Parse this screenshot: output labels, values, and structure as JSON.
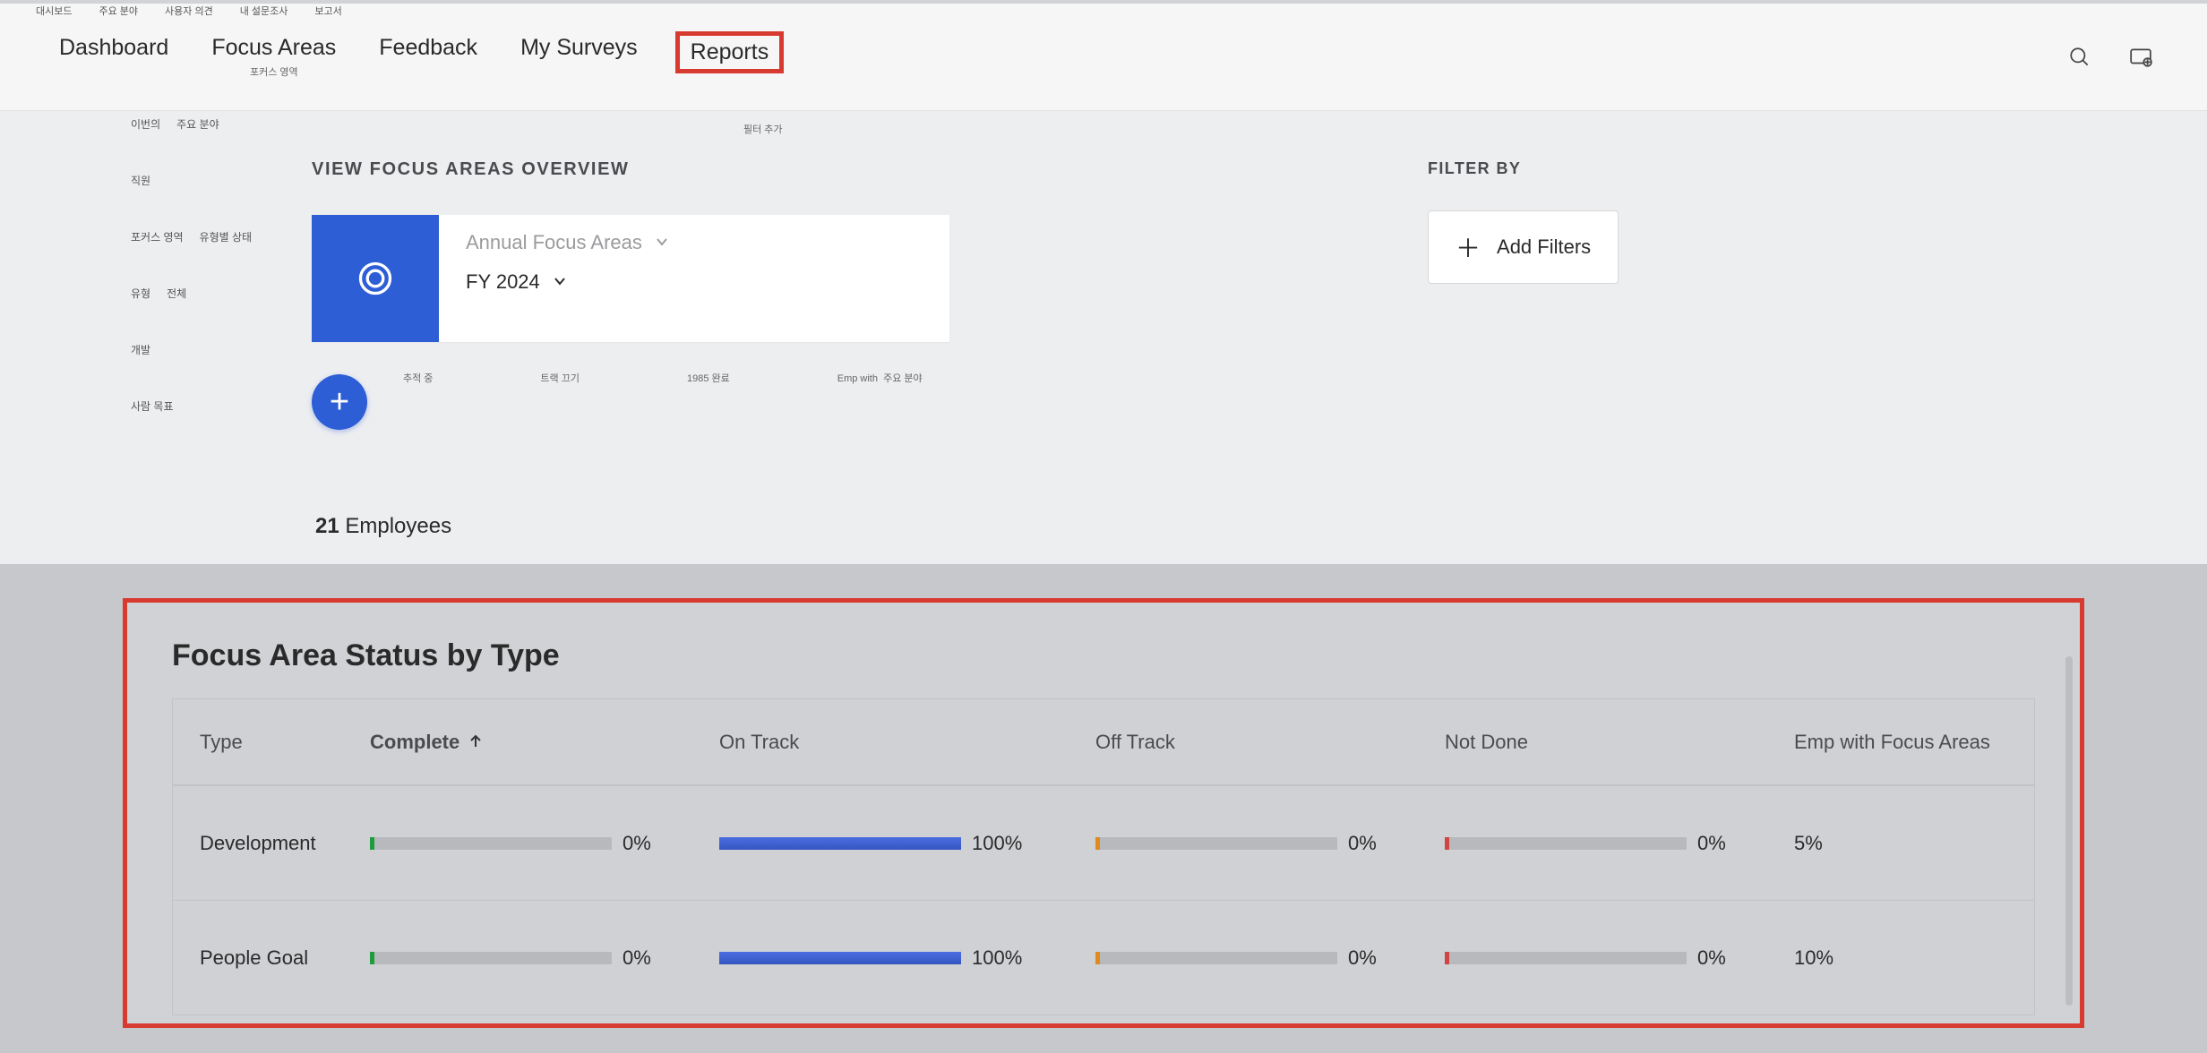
{
  "ko_strip": [
    "대시보드",
    "주요 분야",
    "사용자 의견",
    "내 설문조사",
    "보고서"
  ],
  "nav": {
    "tabs": [
      {
        "label": "Dashboard",
        "ko": ""
      },
      {
        "label": "Focus Areas",
        "ko": "포커스 영역"
      },
      {
        "label": "Feedback",
        "ko": ""
      },
      {
        "label": "My Surveys",
        "ko": ""
      },
      {
        "label": "Reports",
        "ko": ""
      }
    ]
  },
  "overview": {
    "title": "VIEW FOCUS AREAS OVERVIEW",
    "selector_label": "Annual Focus Areas",
    "period_label": "FY 2024",
    "employees_count": "21",
    "employees_label": "Employees",
    "filter_add_label": "필터 추가"
  },
  "engagement_rows": [
    [
      "이번의",
      "주요 분야"
    ],
    [
      "직원"
    ],
    [
      "포커스 영역",
      "유형별 상태"
    ],
    [
      "유형",
      "전체"
    ],
    [
      "개발"
    ],
    [
      "사람 목표"
    ]
  ],
  "tiny_labels": [
    "추적 중",
    "트랙 끄기",
    "1985 완료",
    "Emp with",
    "주요 분야"
  ],
  "filter_panel": {
    "title": "FILTER BY",
    "add_label": "Add Filters"
  },
  "report": {
    "title": "Focus Area Status by Type",
    "columns": {
      "type": "Type",
      "complete": "Complete",
      "on_track": "On Track",
      "off_track": "Off Track",
      "not_done": "Not Done",
      "emp_with": "Emp with Focus Areas"
    },
    "rows": [
      {
        "type": "Development",
        "complete": {
          "pct": "0%",
          "fill": 0,
          "edge": "green"
        },
        "on_track": {
          "pct": "100%",
          "fill": 100,
          "edge": "blue"
        },
        "off_track": {
          "pct": "0%",
          "fill": 0,
          "edge": "orange"
        },
        "not_done": {
          "pct": "0%",
          "fill": 0,
          "edge": "red"
        },
        "emp_with": "5%"
      },
      {
        "type": "People Goal",
        "complete": {
          "pct": "0%",
          "fill": 0,
          "edge": "green"
        },
        "on_track": {
          "pct": "100%",
          "fill": 100,
          "edge": "blue"
        },
        "off_track": {
          "pct": "0%",
          "fill": 0,
          "edge": "orange"
        },
        "not_done": {
          "pct": "0%",
          "fill": 0,
          "edge": "red"
        },
        "emp_with": "10%"
      }
    ]
  },
  "chart_data": {
    "type": "table",
    "title": "Focus Area Status by Type",
    "columns": [
      "Type",
      "Complete",
      "On Track",
      "Off Track",
      "Not Done",
      "Emp with Focus Areas"
    ],
    "rows": [
      [
        "Development",
        0,
        100,
        0,
        0,
        5
      ],
      [
        "People Goal",
        0,
        100,
        0,
        0,
        10
      ]
    ],
    "units": {
      "Complete": "%",
      "On Track": "%",
      "Off Track": "%",
      "Not Done": "%",
      "Emp with Focus Areas": "%"
    }
  }
}
